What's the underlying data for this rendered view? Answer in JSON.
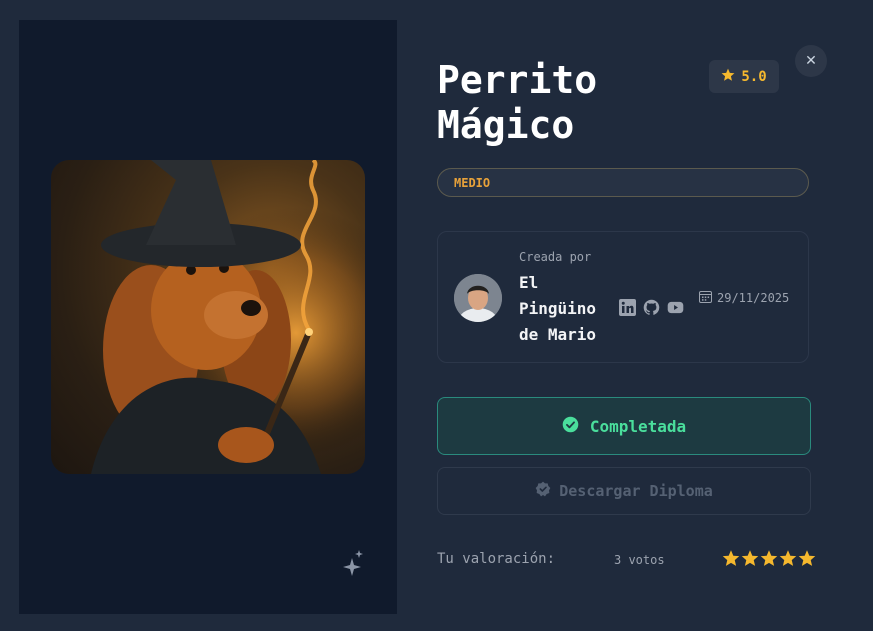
{
  "project": {
    "title_line1": "Perrito",
    "title_line2": "Mágico",
    "rating": "5.0",
    "difficulty": "MEDIO"
  },
  "creator": {
    "created_by_label": "Creada por",
    "name_line1": "El",
    "name_line2": "Pingüino",
    "name_line3": "de Mario",
    "date": "29/11/2025",
    "social_icons": [
      "linkedin-icon",
      "github-icon",
      "youtube-icon"
    ]
  },
  "actions": {
    "completed_label": "Completada",
    "diploma_label": "Descargar Diploma"
  },
  "user_rating": {
    "label": "Tu valoración:",
    "votes": "3 votos",
    "stars": 5,
    "max_stars": 5
  },
  "colors": {
    "background": "#1f2a3c",
    "accent_gold": "#f5b82e",
    "difficulty_orange": "#e8a23a",
    "completed_green": "#4ade9c"
  }
}
